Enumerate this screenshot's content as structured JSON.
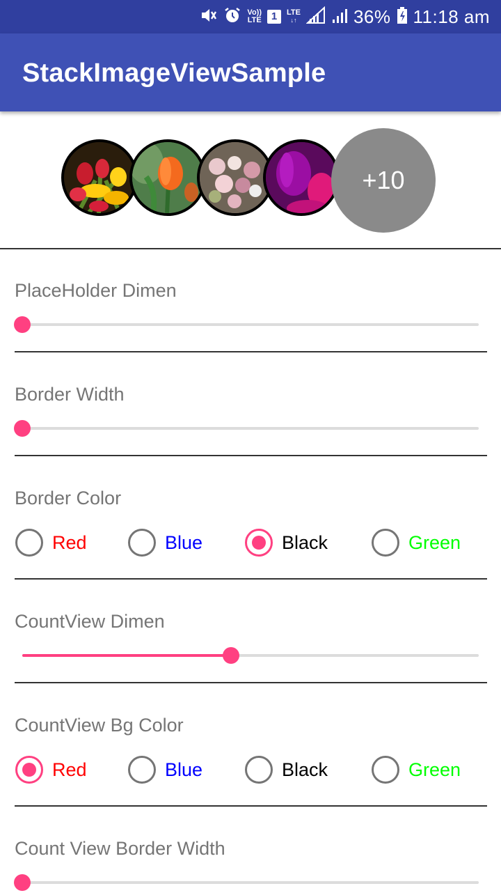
{
  "status_bar": {
    "icons": [
      "mute-icon",
      "alarm-icon",
      "volte-icon",
      "sim1-icon",
      "lte-icon",
      "signal-icon",
      "signal-icon-2",
      "battery-icon"
    ],
    "volte_line1": "Vo))",
    "volte_line2": "LTE",
    "sim_label": "1",
    "lte_label": "LTE",
    "battery_percent": "36%",
    "time": "11:18 am"
  },
  "app_bar": {
    "title": "StackImageViewSample"
  },
  "stack_view": {
    "images": [
      "red-yellow-tulips",
      "orange-tulip",
      "flower-bouquet",
      "purple-tulips"
    ],
    "count_text": "+10",
    "count_bg_color": "#8a8a8a",
    "border_color": "#000000"
  },
  "settings": {
    "placeholder_dimen": {
      "label": "PlaceHolder Dimen",
      "value": 0.0
    },
    "border_width": {
      "label": "Border Width",
      "value": 0.0
    },
    "border_color": {
      "label": "Border Color",
      "options": [
        {
          "label": "Red",
          "color": "#ff0000",
          "checked": false
        },
        {
          "label": "Blue",
          "color": "#0000ff",
          "checked": false
        },
        {
          "label": "Black",
          "color": "#000000",
          "checked": true
        },
        {
          "label": "Green",
          "color": "#00ff00",
          "checked": false
        }
      ]
    },
    "countview_dimen": {
      "label": "CountView Dimen",
      "value": 0.457
    },
    "countview_bg_color": {
      "label": "CountView Bg Color",
      "options": [
        {
          "label": "Red",
          "color": "#ff0000",
          "checked": true
        },
        {
          "label": "Blue",
          "color": "#0000ff",
          "checked": false
        },
        {
          "label": "Black",
          "color": "#000000",
          "checked": false
        },
        {
          "label": "Green",
          "color": "#00ff00",
          "checked": false
        }
      ]
    },
    "count_view_border_width": {
      "label": "Count View Border Width",
      "value": 0.0
    }
  },
  "accent_color": "#ff4081",
  "primary_color": "#3f51b5",
  "primary_dark_color": "#303f9f"
}
